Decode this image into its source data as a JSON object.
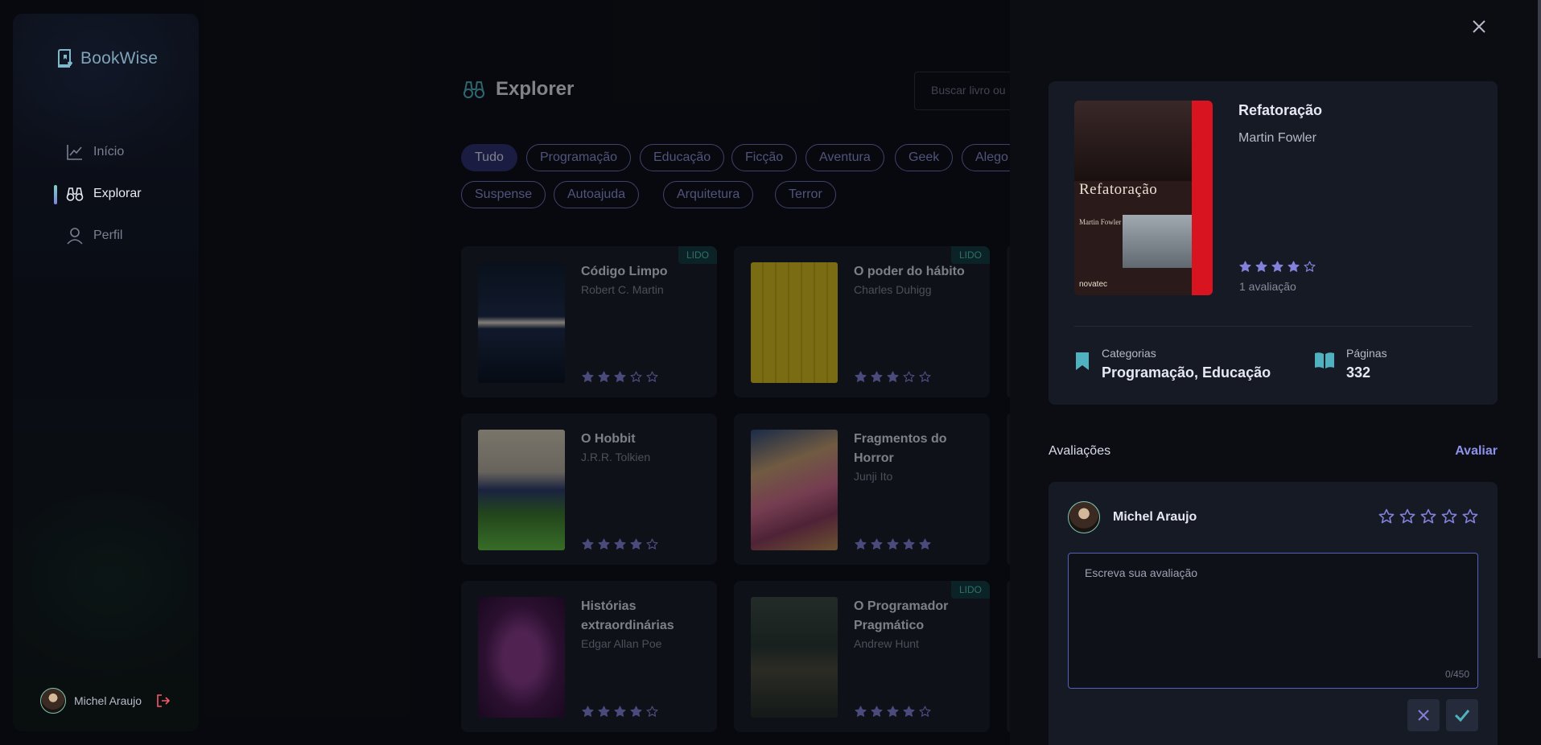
{
  "app": {
    "name": "BookWise"
  },
  "sidebar": {
    "items": [
      {
        "label": "Início",
        "icon": "chart-line-icon"
      },
      {
        "label": "Explorar",
        "icon": "binoculars-icon",
        "active": true
      },
      {
        "label": "Perfil",
        "icon": "user-icon"
      }
    ],
    "user": {
      "name": "Michel Araujo"
    }
  },
  "header": {
    "title": "Explorer",
    "search_placeholder": "Buscar livro ou"
  },
  "tags": [
    "Tudo",
    "Programação",
    "Educação",
    "Ficção",
    "Aventura",
    "Geek",
    "Alego",
    "Suspense",
    "Autoajuda",
    "Arquitetura",
    "Terror"
  ],
  "books": [
    {
      "title": "Código Limpo",
      "author": "Robert C. Martin",
      "rating": 3,
      "read": true,
      "badge": "LIDO",
      "cover_color": "#0c1a2a"
    },
    {
      "title": "O poder do hábito",
      "author": "Charles Duhigg",
      "rating": 3,
      "read": true,
      "badge": "LIDO",
      "cover_color": "#d8c01a"
    },
    {
      "title": "O Hobbit",
      "author": "J.R.R. Tolkien",
      "rating": 4,
      "read": false,
      "badge": "",
      "cover_color": "#3a7a2a"
    },
    {
      "title": "Fragmentos do Horror",
      "author": "Junji Ito",
      "rating": 5,
      "read": false,
      "badge": "",
      "cover_color": "#b0683a"
    },
    {
      "title": "Histórias extraordinárias",
      "author": "Edgar Allan Poe",
      "rating": 4,
      "read": false,
      "badge": "",
      "cover_color": "#4a1850"
    },
    {
      "title": "O Programador Pragmático",
      "author": "Andrew Hunt",
      "rating": 4,
      "read": true,
      "badge": "LIDO",
      "cover_color": "#25362e"
    }
  ],
  "detail": {
    "title": "Refatoração",
    "author": "Martin Fowler",
    "rating": 4,
    "rating_count": "1 avaliação",
    "categories_label": "Categorias",
    "categories_value": "Programação, Educação",
    "pages_label": "Páginas",
    "pages_value": "332",
    "cover_text": "Refatoração",
    "cover_author": "Martin Fowler",
    "cover_publisher": "novatec"
  },
  "reviews": {
    "label": "Avaliações",
    "rate_link": "Avaliar",
    "form": {
      "user": "Michel Araujo",
      "rating": 0,
      "placeholder": "Escreva sua avaliação",
      "counter": "0/450"
    }
  },
  "colors": {
    "accent": "#8d93e8",
    "accent_green": "#50b2c0",
    "star": "#8381d9",
    "badge": "#4ec9b0"
  }
}
